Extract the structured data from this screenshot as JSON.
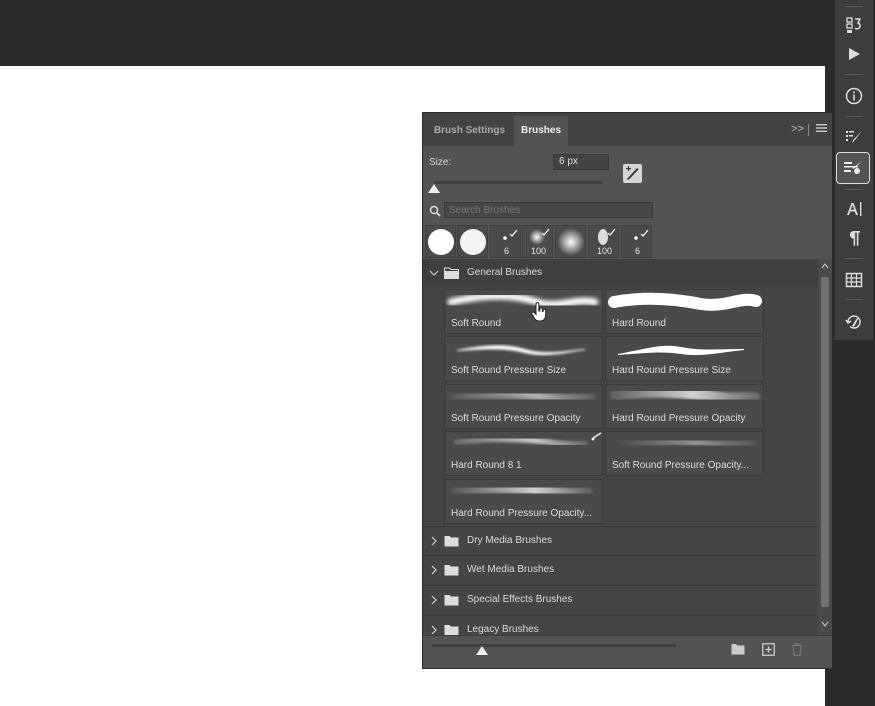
{
  "tool_strip": {
    "icons": [
      "history-icon",
      "play-icon",
      "info-icon",
      "brush-settings-icon",
      "brushes-icon",
      "character-icon",
      "paragraph-icon",
      "glyphs-icon",
      "history-brush-icon"
    ],
    "active": "brushes-icon"
  },
  "panel": {
    "tabs": [
      {
        "label": "Brush Settings",
        "active": false
      },
      {
        "label": "Brushes",
        "active": true
      }
    ],
    "collapse_glyph": ">>",
    "size_label": "Size:",
    "size_value": "6 px",
    "size_slider_level_percent": 1,
    "search_placeholder": "Search Brushes",
    "recent_brushes": [
      {
        "kind": "hard-round",
        "number": ""
      },
      {
        "kind": "hard-round",
        "number": ""
      },
      {
        "kind": "dot",
        "number": "6"
      },
      {
        "kind": "soft-dot",
        "number": "100"
      },
      {
        "kind": "soft-round",
        "number": ""
      },
      {
        "kind": "bristle",
        "number": "100"
      },
      {
        "kind": "dot",
        "number": "6"
      }
    ],
    "groups": [
      {
        "name": "General Brushes",
        "expanded": true
      },
      {
        "name": "Dry Media Brushes",
        "expanded": false
      },
      {
        "name": "Wet Media Brushes",
        "expanded": false
      },
      {
        "name": "Special Effects Brushes",
        "expanded": false
      },
      {
        "name": "Legacy Brushes",
        "expanded": false
      }
    ],
    "brushes": [
      {
        "name": "Soft Round",
        "style": "soft"
      },
      {
        "name": "Hard Round",
        "style": "hard"
      },
      {
        "name": "Soft Round Pressure Size",
        "style": "taper-soft"
      },
      {
        "name": "Hard Round Pressure Size",
        "style": "taper-hard"
      },
      {
        "name": "Soft Round Pressure Opacity",
        "style": "fade-soft"
      },
      {
        "name": "Hard Round Pressure Opacity",
        "style": "fade-hard"
      },
      {
        "name": "Hard Round 8 1",
        "style": "fade-thin"
      },
      {
        "name": "Soft Round Pressure Opacity...",
        "style": "fade-soft-2"
      },
      {
        "name": "Hard Round Pressure Opacity...",
        "style": "fade-hard-2"
      }
    ],
    "preview_size_slider_percent": 20
  },
  "colors": {
    "panel_bg": "#535353",
    "tab_bar_bg": "#434343",
    "list_bg": "#454545",
    "tile_bg": "#4a4a4a",
    "app_bg": "#2b2b2b"
  }
}
